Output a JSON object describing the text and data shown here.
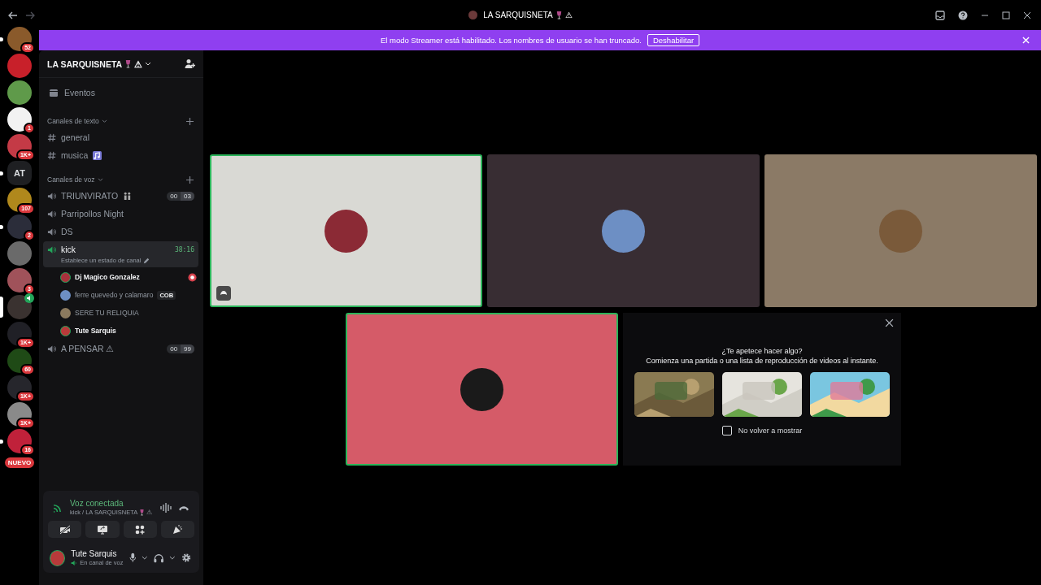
{
  "titlebar": {
    "title": "LA SARQUISNETA",
    "suffix": "⚠"
  },
  "banner": {
    "text": "El modo Streamer está habilitado. Los nombres de usuario se han truncado.",
    "button": "Deshabilitar"
  },
  "servers": [
    {
      "color": "#8a5a2b",
      "badge": "52",
      "unread": true,
      "selected": false,
      "voice": false
    },
    {
      "color": "#c8202a",
      "unread": false,
      "selected": false,
      "voice": false
    },
    {
      "color": "#5f9a4a",
      "unread": false,
      "selected": false,
      "voice": false
    },
    {
      "color": "#f2f2f2",
      "badge": "1",
      "unread": false,
      "selected": false,
      "voice": false
    },
    {
      "color": "#c43a46",
      "badge": "1K+",
      "unread": false,
      "selected": false,
      "voice": false
    },
    {
      "label": "AT",
      "color": "#1e1f22",
      "unread": true,
      "selected": false,
      "voice": false
    },
    {
      "color": "#b0881c",
      "badge": "107",
      "unread": false,
      "selected": false,
      "voice": false
    },
    {
      "color": "#2b2d3a",
      "badge": "2",
      "unread": true,
      "selected": false,
      "voice": false
    },
    {
      "color": "#6a6a6a",
      "unread": false,
      "selected": false,
      "voice": false
    },
    {
      "color": "#a0525a",
      "badge": "3",
      "unread": false,
      "selected": false,
      "voice": false
    },
    {
      "color": "#3a3230",
      "unread": false,
      "selected": true,
      "voice": true
    },
    {
      "color": "#202026",
      "badge": "1K+",
      "unread": false,
      "selected": false,
      "voice": false
    },
    {
      "color": "#1f4a16",
      "badge": "60",
      "unread": false,
      "selected": false,
      "voice": false
    },
    {
      "color": "#26262c",
      "badge": "1K+",
      "unread": false,
      "selected": false,
      "voice": false
    },
    {
      "color": "#8a8a8a",
      "badge": "1K+",
      "unread": false,
      "selected": false,
      "voice": false
    },
    {
      "color": "#c0213a",
      "badge": "16",
      "unread": true,
      "selected": false,
      "voice": false
    }
  ],
  "new_badge": "NUEVO",
  "server": {
    "name": "LA SARQUISNETA",
    "suffix": "⚠"
  },
  "events": "Eventos",
  "categories": [
    {
      "name": "Canales de texto",
      "kind": "text",
      "channels": [
        {
          "name": "general",
          "selected": false
        },
        {
          "name": "musica",
          "selected": false
        }
      ]
    },
    {
      "name": "Canales de voz",
      "kind": "voice",
      "channels": [
        {
          "name": "TRIUNVIRATO",
          "selected": false,
          "limit": [
            "00",
            "03"
          ]
        },
        {
          "name": "Parripollos Night",
          "selected": false
        },
        {
          "name": "DS",
          "selected": false
        },
        {
          "name": "kick",
          "selected": true,
          "timer": "38:16",
          "status": "Establece un estado de canal",
          "members": [
            {
              "name": "Dj Magico Gonzalez",
              "color": "#a8323c",
              "speaking": true,
              "activity": true
            },
            {
              "name": "ferre quevedo y calamaro",
              "color": "#6d8fc4",
              "speaking": false,
              "tag": "COB"
            },
            {
              "name": "SERE TU RELIQUIA",
              "color": "#8c7a5e",
              "speaking": false
            },
            {
              "name": "Tute Sarquis",
              "color": "#b83a3a",
              "speaking": true
            }
          ]
        },
        {
          "name": "A PENSAR ⚠",
          "selected": false,
          "limit": [
            "00",
            "99"
          ]
        }
      ]
    }
  ],
  "voice_panel": {
    "status": "Voz conectada",
    "location": "kick / LA SARQUISNETA",
    "suffix": "⚠"
  },
  "user": {
    "name": "Tute Sarquis",
    "status": "En canal de voz",
    "color": "#b83a3a"
  },
  "tiles": [
    {
      "color": "#d9d9d4",
      "speaking": true,
      "activity": true
    },
    {
      "color": "#382d33",
      "speaking": false,
      "activity": false
    },
    {
      "color": "#8b7a66",
      "speaking": false,
      "activity": false
    },
    {
      "color": "#d55b68",
      "speaking": true,
      "activity": false
    }
  ],
  "activity": {
    "title": "¿Te apetece hacer algo?",
    "subtitle": "Comienza una partida o una lista de reproducción de videos al instante.",
    "checkbox": {
      "label": "No volver a mostrar",
      "checked": false
    }
  }
}
